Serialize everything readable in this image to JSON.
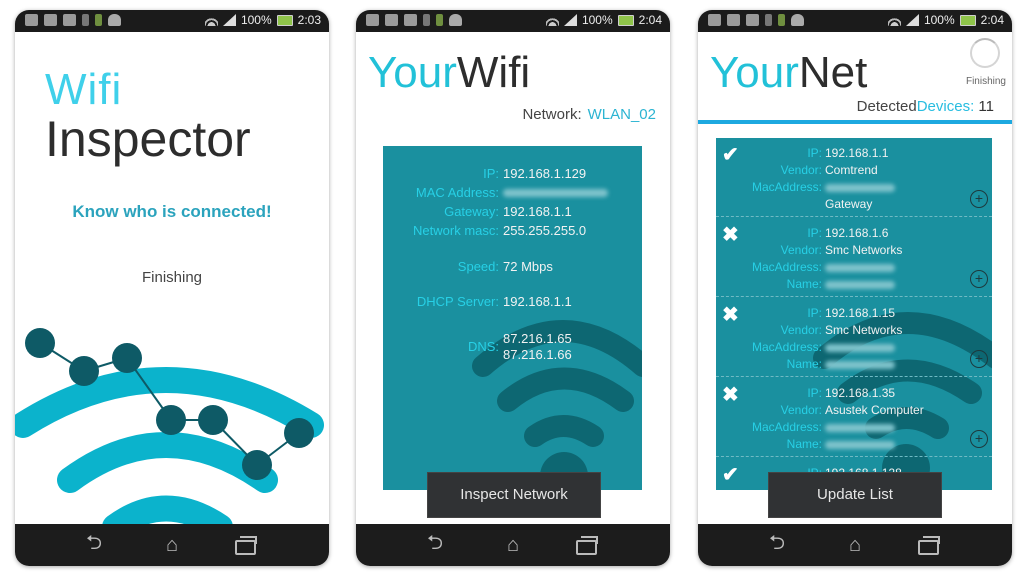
{
  "status_bar": [
    {
      "battery": "100%",
      "time": "2:03"
    },
    {
      "battery": "100%",
      "time": "2:04"
    },
    {
      "battery": "100%",
      "time": "2:04"
    }
  ],
  "screen1": {
    "title_line1": "Wifi",
    "title_line2": "Inspector",
    "tagline": "Know who is connected!",
    "status": "Finishing"
  },
  "screen2": {
    "title_a": "Your",
    "title_b": "Wifi",
    "network_label": "Network:",
    "network_value": "WLAN_02",
    "info": [
      {
        "key": "IP:",
        "value": "192.168.1.129"
      },
      {
        "key": "MAC Address:",
        "value": ""
      },
      {
        "key": "Gateway:",
        "value": "192.168.1.1"
      },
      {
        "key": "Network masc:",
        "value": "255.255.255.0"
      },
      {
        "key": "Speed:",
        "value": "72 Mbps"
      },
      {
        "key": "DHCP Server:",
        "value": "192.168.1.1"
      },
      {
        "key": "DNS:",
        "value": "87.216.1.65"
      },
      {
        "key": "",
        "value": "87.216.1.66"
      }
    ],
    "button": "Inspect Network"
  },
  "screen3": {
    "title_a": "Your",
    "title_b": "Net",
    "spinner_label": "Finishing",
    "detected_a": "Detected",
    "detected_b": "Devices:",
    "detected_count": "11",
    "devices": [
      {
        "status": "check",
        "ip": "192.168.1.1",
        "vendor": "Comtrend",
        "extra_key": "",
        "extra_value": "Gateway"
      },
      {
        "status": "cross",
        "ip": "192.168.1.6",
        "vendor": "Smc Networks",
        "extra_key": "Name:",
        "extra_value": ""
      },
      {
        "status": "cross",
        "ip": "192.168.1.15",
        "vendor": "Smc Networks",
        "extra_key": "Name:",
        "extra_value": ""
      },
      {
        "status": "cross",
        "ip": "192.168.1.35",
        "vendor": "Asustek Computer",
        "extra_key": "Name:",
        "extra_value": ""
      },
      {
        "status": "check",
        "ip": "192.168.1.128",
        "vendor": "",
        "extra_key": "",
        "extra_value": ""
      }
    ],
    "labels": {
      "ip": "IP:",
      "vendor": "Vendor:",
      "mac": "MacAddress:"
    },
    "button": "Update List"
  },
  "icons": {
    "check": "✔",
    "cross": "✖",
    "plus": "+",
    "back": "⮌",
    "home": "⌂"
  }
}
